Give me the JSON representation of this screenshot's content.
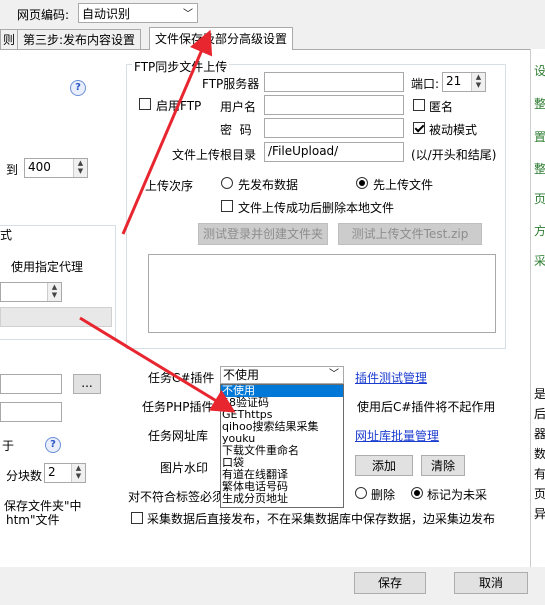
{
  "header": {
    "encoding_label": "网页编码:",
    "encoding_value": "自动识别"
  },
  "tabs": [
    {
      "label": "则"
    },
    {
      "label": "第三步:发布内容设置"
    },
    {
      "label": "文件保存及部分高级设置"
    }
  ],
  "left_panel": {
    "to_label": "到",
    "to_value": "400",
    "partial_text": "式",
    "proxy_label": "使用指定代理",
    "browse_label": "...",
    "fen_label": "于",
    "block_label": "分块数",
    "block_value": "2",
    "save_folder_text": "保存文件夹\"中",
    "htm_text": "htm\"文件"
  },
  "ftp": {
    "group_title": "FTP同步文件上传",
    "enable_label": "启用FTP",
    "server_label": "FTP服务器",
    "port_label": "端口:",
    "port_value": "21",
    "user_label": "用户名",
    "anonymous_label": "匿名",
    "password_label": "密  码",
    "passive_label": "被动模式",
    "root_dir_label": "文件上传根目录",
    "root_dir_value": "/FileUpload/",
    "root_dir_hint": "(以/开头和结尾)",
    "order_label": "上传次序",
    "order_option1": "先发布数据",
    "order_option2": "先上传文件",
    "delete_local_label": "文件上传成功后删除本地文件",
    "test_login_button": "测试登录并创建文件夹",
    "test_upload_button": "测试上传文件Test.zip"
  },
  "plugins": {
    "csharp_label": "任务C#插件",
    "csharp_value": "不使用",
    "plugin_test_link": "插件测试管理",
    "php_label": "任务PHP插件",
    "php_note": "使用后C#插件将不起作用",
    "url_db_label": "任务网址库",
    "url_db_link": "网址库批量管理",
    "watermark_label": "图片水印",
    "add_button": "添加",
    "clear_button": "清除",
    "nonconform_label": "对不符合标签必须",
    "delete_label": "删除",
    "mark_unused_label": "标记为未采",
    "direct_publish_label": "采集数据后直接发布，不在采集数据库中保存数据，边采集边发布"
  },
  "dropdown": {
    "items": [
      "不使用",
      "58验证码",
      "GEThttps",
      "qihoo搜索结果采集",
      "youku",
      "下载文件重命名",
      "口袋",
      "有道在线翻译",
      "繁体电话号码",
      "生成分页地址"
    ]
  },
  "footer": {
    "save_button": "保存",
    "cancel_button": "取消"
  },
  "right_edge": [
    "设",
    "整",
    "置",
    "整",
    "页",
    "方",
    "采",
    "是",
    "后",
    "器",
    "数",
    "有",
    "页",
    "异"
  ]
}
